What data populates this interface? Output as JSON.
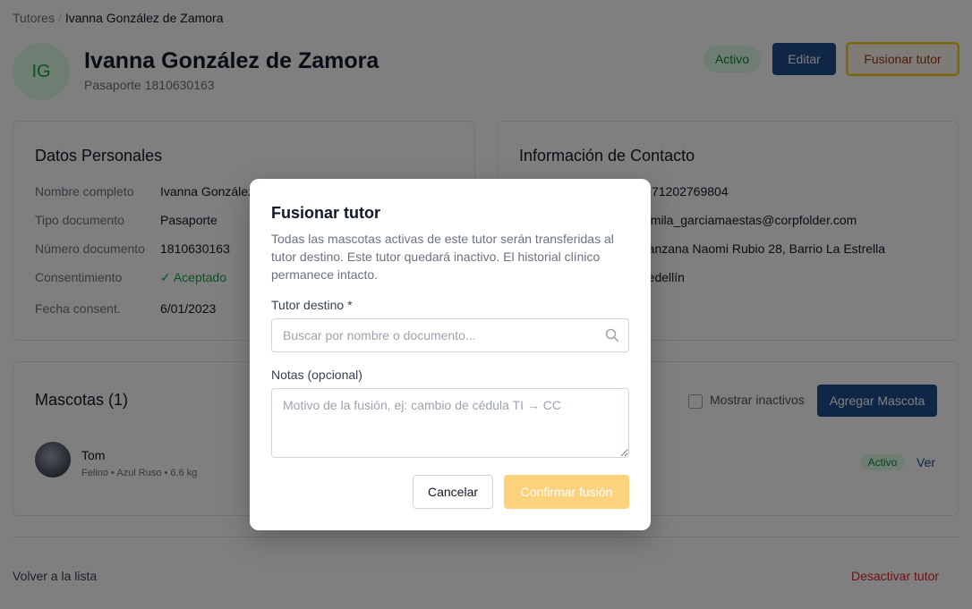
{
  "breadcrumb": {
    "root": "Tutores",
    "separator": "/",
    "current": "Ivanna González de Zamora"
  },
  "header": {
    "initials": "IG",
    "name": "Ivanna González de Zamora",
    "document": "Pasaporte 1810630163",
    "status": "Activo",
    "edit_label": "Editar",
    "merge_label": "Fusionar tutor"
  },
  "personal": {
    "title": "Datos Personales",
    "fields": [
      {
        "label": "Nombre completo",
        "value": "Ivanna González de Zamora"
      },
      {
        "label": "Tipo documento",
        "value": "Pasaporte"
      },
      {
        "label": "Número documento",
        "value": "1810630163"
      },
      {
        "label": "Consentimiento",
        "value": "✓ Aceptado"
      },
      {
        "label": "Fecha consent.",
        "value": "6/01/2023"
      }
    ]
  },
  "contact": {
    "title": "Información de Contacto",
    "values": [
      "+571202769804",
      "camila_garciamaestas@corpfolder.com",
      "Manzana Naomi Rubio 28, Barrio La Estrella",
      "Medellín"
    ]
  },
  "pets": {
    "title": "Mascotas (1)",
    "show_inactive_label": "Mostrar inactivos",
    "add_label": "Agregar Mascota",
    "items": [
      {
        "name": "Tom",
        "meta": "Felino • Azul Ruso • 6.6 kg",
        "status": "Activo",
        "view_label": "Ver"
      }
    ]
  },
  "footer": {
    "back_label": "Volver a la lista",
    "deactivate_label": "Desactivar tutor"
  },
  "modal": {
    "title": "Fusionar tutor",
    "description": "Todas las mascotas activas de este tutor serán transferidas al tutor destino. Este tutor quedará inactivo. El historial clínico permanece intacto.",
    "target_label": "Tutor destino *",
    "target_placeholder": "Buscar por nombre o documento...",
    "notes_label": "Notas (opcional)",
    "notes_placeholder": "Motivo de la fusión, ej: cambio de cédula TI → CC",
    "cancel_label": "Cancelar",
    "confirm_label": "Confirmar fusión"
  },
  "colors": {
    "primary": "#1e4d8c",
    "success": "#16a34a",
    "danger": "#dc2626",
    "accent": "#facc15"
  }
}
